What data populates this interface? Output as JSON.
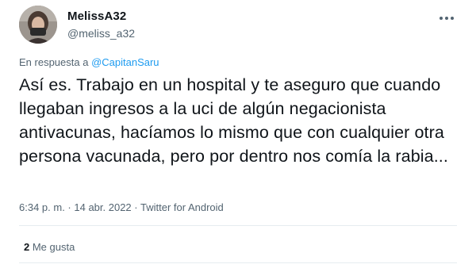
{
  "tweet": {
    "display_name": "MelissA32",
    "handle": "@meliss_a32",
    "more_icon": "more-horizontal-icon",
    "reply_prefix": "En respuesta a ",
    "reply_mention": "@CapitanSaru",
    "text": "Así es. Trabajo en un hospital y te aseguro que cuando llegaban ingresos a la uci de algún negacionista antivacunas, hacíamos lo mismo que con cualquier otra persona vacunada, pero por dentro nos comía la rabia...",
    "time": "6:34 p. m.",
    "separator": " · ",
    "date": "14 abr. 2022",
    "source": "Twitter for Android",
    "likes_count": "2",
    "likes_label": " Me gusta"
  },
  "colors": {
    "text": "#0f1419",
    "secondary": "#536471",
    "link": "#1d9bf0",
    "divider": "#e6ecf0"
  }
}
